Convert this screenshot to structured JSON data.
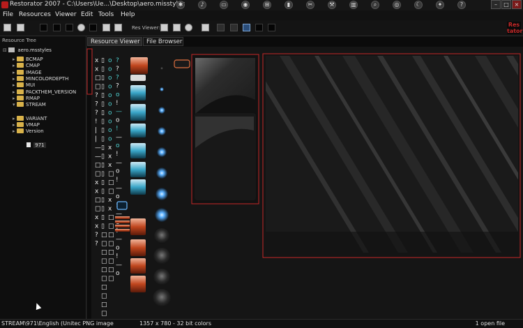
{
  "window": {
    "title": "Restorator 2007 - C:\\Users\\Ue...\\Desktop\\aero.misstyles",
    "controls": [
      "minimize",
      "maximize",
      "close"
    ]
  },
  "taskbar_icons": [
    "settings-icon",
    "bell-icon",
    "monitor-icon",
    "gamepad-icon",
    "windows-icon",
    "battery-icon",
    "cut-icon",
    "hammer-icon",
    "trash-icon",
    "zoom-icon",
    "target-icon",
    "moon-icon",
    "compass-icon",
    "help-icon"
  ],
  "menu": [
    "File",
    "Resources",
    "Viewer",
    "Edit",
    "Tools",
    "Help"
  ],
  "toolbar": {
    "res_viewer_label": "Res Viewer:",
    "logo_line1": "Res",
    "logo_line2": "tator"
  },
  "sidebar": {
    "title": "Resource Tree",
    "root": "aero.msstyles",
    "items": [
      {
        "label": "BCMAP",
        "expanded": false
      },
      {
        "label": "CMAP",
        "expanded": false
      },
      {
        "label": "IMAGE",
        "expanded": false
      },
      {
        "label": "MINCOLORDEPTH",
        "expanded": false
      },
      {
        "label": "MUI",
        "expanded": false
      },
      {
        "label": "PACKTHEM_VERSION",
        "expanded": false
      },
      {
        "label": "RMAP",
        "expanded": false
      },
      {
        "label": "STREAM",
        "expanded": true
      },
      {
        "label": "VARIANT",
        "expanded": false
      },
      {
        "label": "VMAP",
        "expanded": false
      },
      {
        "label": "Version",
        "expanded": false
      }
    ],
    "selected_leaf": "971"
  },
  "tabs": [
    {
      "label": "Resource Viewer",
      "active": true
    },
    {
      "label": "File Browser",
      "active": false
    }
  ],
  "status": {
    "path": "STREAM\\971\\English (Unitec PNG image",
    "info": "1357 x 780 - 32 bit colors",
    "open_files": "1 open file"
  },
  "colors": {
    "background": "#0b0b0b",
    "accent_red": "#c62828",
    "folder_yellow": "#d9b24a",
    "glow_blue": "#5ab0ff"
  }
}
